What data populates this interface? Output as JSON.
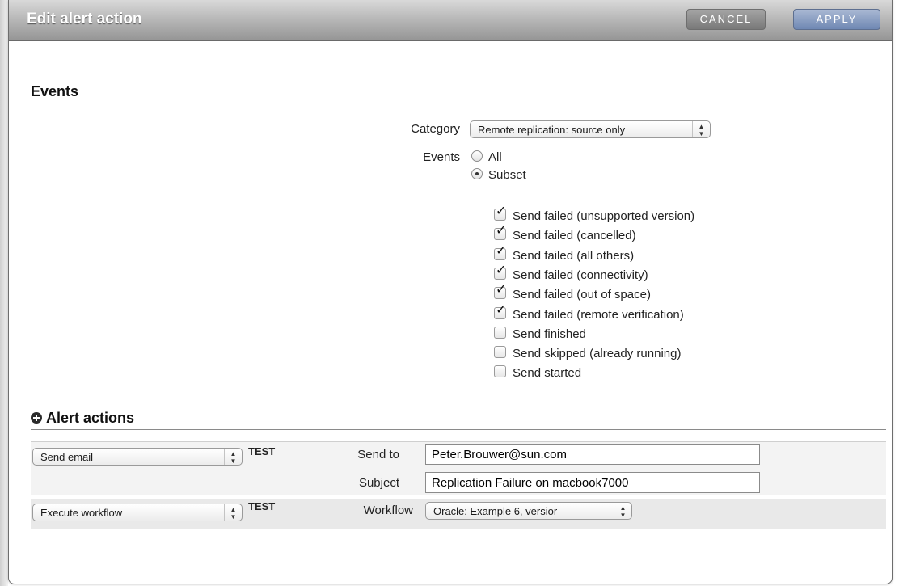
{
  "dialog": {
    "title": "Edit alert action",
    "cancel_label": "CANCEL",
    "apply_label": "APPLY"
  },
  "events_section": {
    "title": "Events",
    "category_label": "Category",
    "category_value": "Remote replication: source only",
    "events_label": "Events",
    "radio_all": "All",
    "radio_subset": "Subset",
    "selected_radio": "Subset",
    "checkbox_items": [
      {
        "label": "Send failed (unsupported version)",
        "checked": true
      },
      {
        "label": "Send failed (cancelled)",
        "checked": true
      },
      {
        "label": "Send failed (all others)",
        "checked": true
      },
      {
        "label": "Send failed (connectivity)",
        "checked": true
      },
      {
        "label": "Send failed (out of space)",
        "checked": true
      },
      {
        "label": "Send failed (remote verification)",
        "checked": true
      },
      {
        "label": "Send finished",
        "checked": false
      },
      {
        "label": "Send skipped (already running)",
        "checked": false
      },
      {
        "label": "Send started",
        "checked": false
      }
    ]
  },
  "alert_actions": {
    "title": "Alert actions",
    "rows": [
      {
        "action_select": "Send email",
        "test_label": "TEST",
        "send_to_label": "Send to",
        "send_to_value": "Peter.Brouwer@sun.com",
        "subject_label": "Subject",
        "subject_value": "Replication Failure on macbook7000"
      },
      {
        "action_select": "Execute workflow",
        "test_label": "TEST",
        "workflow_label": "Workflow",
        "workflow_value": "Oracle: Example 6, versior"
      }
    ]
  },
  "icons": {
    "add": "plus-circle-icon",
    "select_arrows": "updown-arrows-icon",
    "check": "checkmark-icon"
  }
}
